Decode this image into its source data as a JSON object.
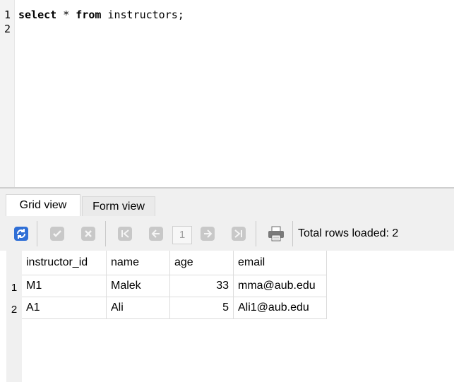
{
  "editor": {
    "lines": [
      {
        "num": "1",
        "kw1": "select",
        "star": " * ",
        "kw2": "from",
        "rest": " instructors;"
      },
      {
        "num": "2"
      }
    ]
  },
  "tabs": {
    "grid_view": "Grid view",
    "form_view": "Form view"
  },
  "toolbar": {
    "icons": [
      "refresh-icon",
      "commit-icon",
      "rollback-icon",
      "first-page-icon",
      "previous-page-icon",
      "next-page-icon",
      "last-page-icon",
      "print-icon"
    ],
    "page": "1",
    "total_rows": "Total rows loaded: 2"
  },
  "grid": {
    "columns": [
      "instructor_id",
      "name",
      "age",
      "email"
    ],
    "rows": [
      {
        "num": "1",
        "instructor_id": "M1",
        "name": "Malek",
        "age": "33",
        "email": "mma@aub.edu"
      },
      {
        "num": "2",
        "instructor_id": "A1",
        "name": "Ali",
        "age": "5",
        "email": "Ali1@aub.edu"
      }
    ]
  }
}
